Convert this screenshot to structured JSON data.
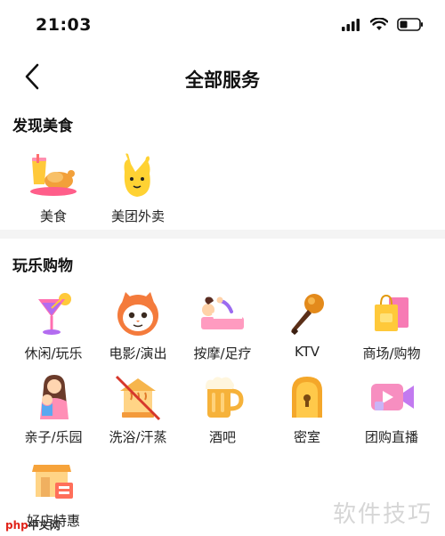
{
  "status": {
    "time": "21:03"
  },
  "header": {
    "title": "全部服务"
  },
  "sections": [
    {
      "title": "发现美食",
      "items": [
        {
          "label": "美食"
        },
        {
          "label": "美团外卖"
        }
      ]
    },
    {
      "title": "玩乐购物",
      "items": [
        {
          "label": "休闲/玩乐"
        },
        {
          "label": "电影/演出"
        },
        {
          "label": "按摩/足疗"
        },
        {
          "label": "KTV"
        },
        {
          "label": "商场/购物"
        },
        {
          "label": "亲子/乐园"
        },
        {
          "label": "洗浴/汗蒸"
        },
        {
          "label": "酒吧"
        },
        {
          "label": "密室"
        },
        {
          "label": "团购直播"
        },
        {
          "label": "好店特惠"
        }
      ]
    }
  ],
  "watermark": {
    "text": "软件技巧",
    "logo_a": "php",
    "logo_b": "中文网"
  },
  "icons": [
    "signal-icon",
    "wifi-icon",
    "battery-icon",
    "back-arrow-icon"
  ]
}
